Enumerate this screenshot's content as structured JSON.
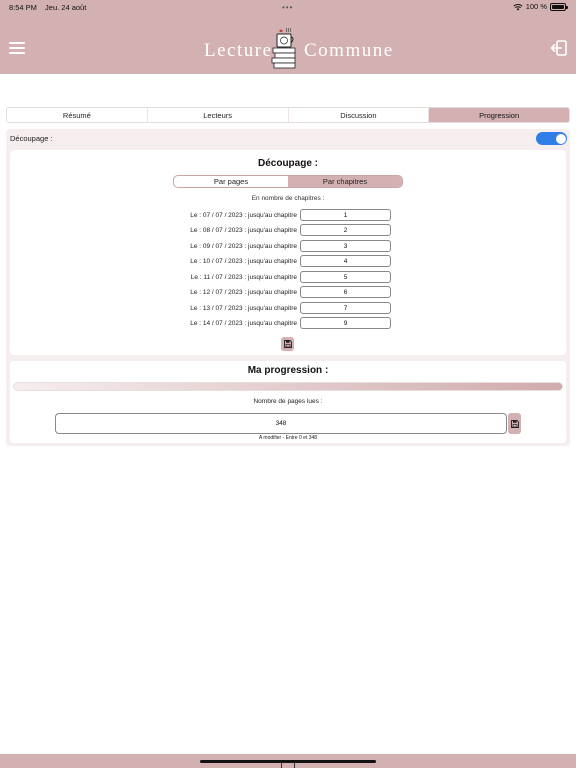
{
  "status_bar": {
    "time": "8:54 PM",
    "date": "Jeu. 24 août",
    "dots": "•••",
    "battery": "100 %"
  },
  "header": {
    "logo_left": "Lecture",
    "logo_right": "Commune",
    "menu_icon": "hamburger-menu-icon",
    "logout_icon": "logout-icon"
  },
  "tabs": [
    {
      "label": "Résumé",
      "active": false
    },
    {
      "label": "Lecteurs",
      "active": false
    },
    {
      "label": "Discussion",
      "active": false
    },
    {
      "label": "Progression",
      "active": true
    }
  ],
  "decoupage_toggle": {
    "label": "Découpage :",
    "on": true,
    "color": "#2f7ee8"
  },
  "decoupage_card": {
    "title": "Découpage :",
    "segments": [
      {
        "label": "Par pages",
        "active": false
      },
      {
        "label": "Par chapitres",
        "active": true
      }
    ],
    "subtitle": "En nombre de chapitres :",
    "rows": [
      {
        "label": "Le : 07 / 07 / 2023 : jusqu'au chapitre",
        "value": "1"
      },
      {
        "label": "Le : 08 / 07 / 2023 : jusqu'au chapitre",
        "value": "2"
      },
      {
        "label": "Le : 09 / 07 / 2023 : jusqu'au chapitre",
        "value": "3"
      },
      {
        "label": "Le : 10 / 07 / 2023 : jusqu'au chapitre",
        "value": "4"
      },
      {
        "label": "Le : 11 / 07 / 2023 : jusqu'au chapitre",
        "value": "5"
      },
      {
        "label": "Le : 12 / 07 / 2023 : jusqu'au chapitre",
        "value": "6"
      },
      {
        "label": "Le : 13 / 07 / 2023 : jusqu'au chapitre",
        "value": "7"
      },
      {
        "label": "Le : 14 / 07 / 2023 : jusqu'au chapitre",
        "value": "9"
      }
    ],
    "save_icon": "save-icon"
  },
  "progression_card": {
    "title": "Ma progression :",
    "pages_label": "Nombre de pages lues :",
    "pages_value": "348",
    "hint": "A modifier - Entre 0 et 348",
    "save_icon": "save-icon"
  },
  "colors": {
    "accent": "#d3b1b2",
    "background": "#f6eeee"
  }
}
